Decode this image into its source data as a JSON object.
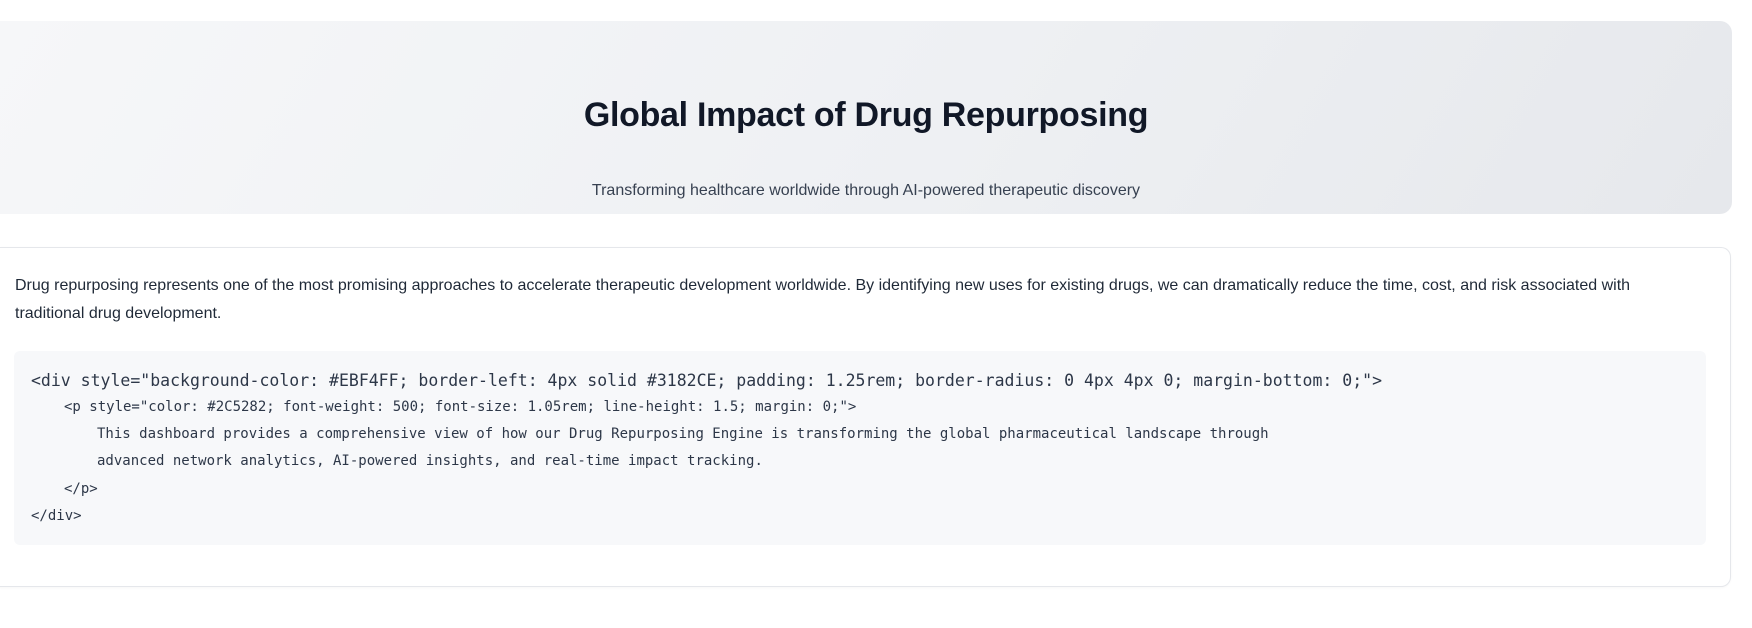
{
  "hero": {
    "title": "Global Impact of Drug Repurposing",
    "subtitle": "Transforming healthcare worldwide through AI-powered therapeutic discovery"
  },
  "content": {
    "intro": "Drug repurposing represents one of the most promising approaches to accelerate therapeutic development worldwide. By identifying new uses for existing drugs, we can dramatically reduce the time, cost, and risk associated with traditional drug development.",
    "code_lines": [
      "<div style=\"background-color: #EBF4FF; border-left: 4px solid #3182CE; padding: 1.25rem; border-radius: 0 4px 4px 0; margin-bottom: 0;\">",
      "<p style=\"color: #2C5282; font-weight: 500; font-size: 1.05rem; line-height: 1.5; margin: 0;\">",
      "This dashboard provides a comprehensive view of how our Drug Repurposing Engine is transforming the global pharmaceutical landscape through",
      "advanced network analytics, AI-powered insights, and real-time impact tracking.",
      "</p>",
      "</div>"
    ]
  }
}
